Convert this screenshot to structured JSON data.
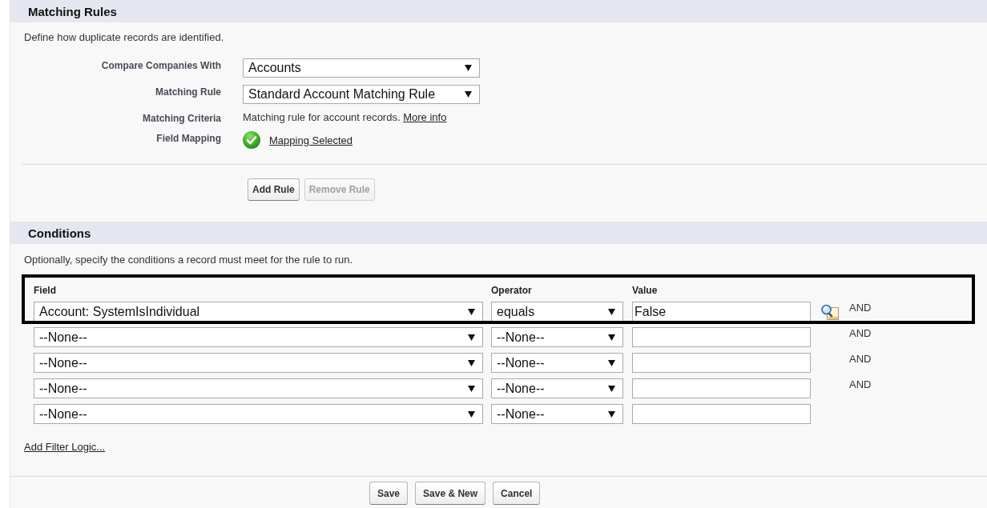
{
  "matching_rules": {
    "title": "Matching Rules",
    "description": "Define how duplicate records are identified.",
    "fields": [
      {
        "label": "Compare Companies With",
        "kind": "select",
        "value": "Accounts"
      },
      {
        "label": "Matching Rule",
        "kind": "select",
        "value": "Standard Account Matching Rule"
      },
      {
        "label": "Matching Criteria",
        "kind": "text",
        "value": "Matching rule for account records.",
        "link": "More info"
      },
      {
        "label": "Field Mapping",
        "kind": "status",
        "link": "Mapping Selected"
      }
    ],
    "buttons": [
      {
        "label": "Add Rule",
        "disabled": false
      },
      {
        "label": "Remove Rule",
        "disabled": true
      }
    ]
  },
  "conditions": {
    "title": "Conditions",
    "description": "Optionally, specify the conditions a record must meet for the rule to run.",
    "columns": [
      "Field",
      "Operator",
      "Value"
    ],
    "rows": [
      {
        "field": "Account: SystemIsIndividual",
        "operator": "equals",
        "value": "False",
        "lookup": true,
        "conjunction": "AND",
        "highlighted": true
      },
      {
        "field": "--None--",
        "operator": "--None--",
        "lookup": false,
        "conjunction": "AND",
        "highlighted": false
      },
      {
        "field": "--None--",
        "operator": "--None--",
        "lookup": false,
        "conjunction": "AND",
        "highlighted": false
      },
      {
        "field": "--None--",
        "operator": "--None--",
        "lookup": false,
        "conjunction": "AND",
        "highlighted": false
      },
      {
        "field": "--None--",
        "operator": "--None--",
        "lookup": false,
        "highlighted": false
      }
    ],
    "filter_logic_link": "Add Filter Logic..."
  },
  "footer_buttons": [
    "Save",
    "Save & New",
    "Cancel"
  ]
}
